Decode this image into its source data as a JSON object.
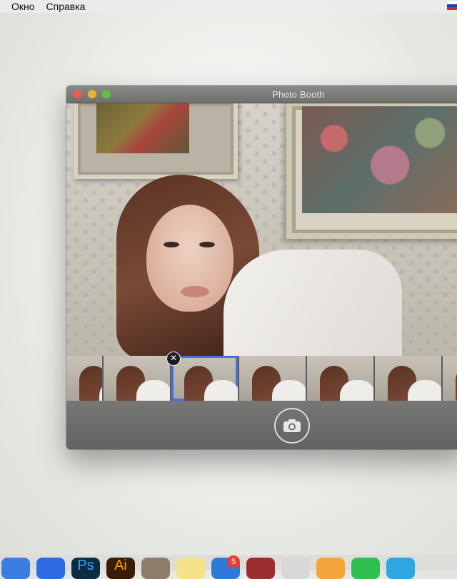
{
  "menubar": {
    "items": [
      "Окно",
      "Справка"
    ]
  },
  "window": {
    "title": "Photo Booth"
  },
  "filmstrip": {
    "thumbnails": 7,
    "selected_index": 2,
    "delete_glyph": "✕"
  },
  "dock": {
    "icons": [
      {
        "name": "finder-icon",
        "color": "#3b7de0"
      },
      {
        "name": "zoom-icon",
        "color": "#2d6be5"
      },
      {
        "name": "photoshop-icon",
        "color": "#0c2b45",
        "label": "Ps"
      },
      {
        "name": "illustrator-icon",
        "color": "#3a1b04",
        "label": "Ai"
      },
      {
        "name": "app-icon",
        "color": "#8e7c68"
      },
      {
        "name": "notes-icon",
        "color": "#f4e28b"
      },
      {
        "name": "xcode-icon",
        "color": "#2f7ad9"
      },
      {
        "name": "photo-booth-icon",
        "color": "#9b2e2e"
      },
      {
        "name": "screenshot-icon",
        "color": "#d8d8d8"
      },
      {
        "name": "photos-icon",
        "color": "#f3a53b"
      },
      {
        "name": "whatsapp-icon",
        "color": "#30c04f"
      },
      {
        "name": "telegram-icon",
        "color": "#2ea6e0"
      },
      {
        "name": "preview-icon",
        "color": "#5a8fd0"
      }
    ],
    "badge_count": "5",
    "ps_label": "Ps",
    "ai_label": "Ai"
  }
}
